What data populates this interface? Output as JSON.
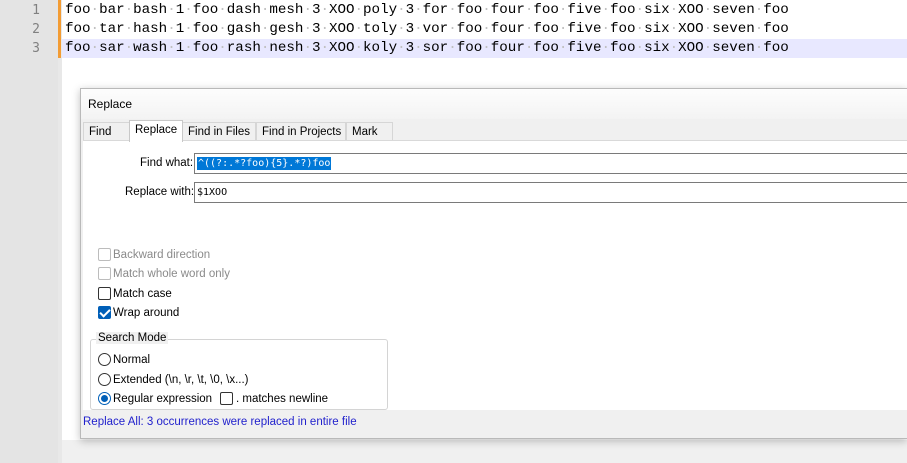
{
  "editor": {
    "lines": [
      {
        "number": "1",
        "text": "foo bar bash 1 foo dash mesh 3 XOO poly 3 for foo four foo five foo six XOO seven foo"
      },
      {
        "number": "2",
        "text": "foo tar hash 1 foo gash gesh 3 XOO toly 3 vor foo four foo five foo six XOO seven foo"
      },
      {
        "number": "3",
        "text": "foo sar wash 1 foo rash nesh 3 XOO koly 3 sor foo four foo five foo six XOO seven foo"
      }
    ]
  },
  "dialog": {
    "title": "Replace",
    "tabs": [
      "Find",
      "Replace",
      "Find in Files",
      "Find in Projects",
      "Mark"
    ],
    "active_tab": "Replace",
    "find_what_label": "Find what:",
    "find_what_value": "^((?:.*?foo){5}.*?)foo",
    "replace_with_label": "Replace with:",
    "replace_with_value": "$1XOO",
    "options": {
      "backward_direction": {
        "label": "Backward direction",
        "checked": false,
        "enabled": false
      },
      "match_whole_word": {
        "label": "Match whole word only",
        "checked": false,
        "enabled": false
      },
      "match_case": {
        "label": "Match case",
        "checked": false,
        "enabled": true
      },
      "wrap_around": {
        "label": "Wrap around",
        "checked": true,
        "enabled": true
      }
    },
    "search_mode": {
      "title": "Search Mode",
      "normal": "Normal",
      "extended": "Extended (\\n, \\r, \\t, \\0, \\x...)",
      "regex": "Regular expression",
      "matches_newline": ". matches newline",
      "selected": "Regular expression"
    },
    "status": "Replace All: 3 occurrences were replaced in entire file"
  },
  "colors": {
    "status_text": "#1f1fcc",
    "selection": "#0078d7",
    "change_bar": "#f39c34",
    "current_line": "#e8e8ff"
  }
}
